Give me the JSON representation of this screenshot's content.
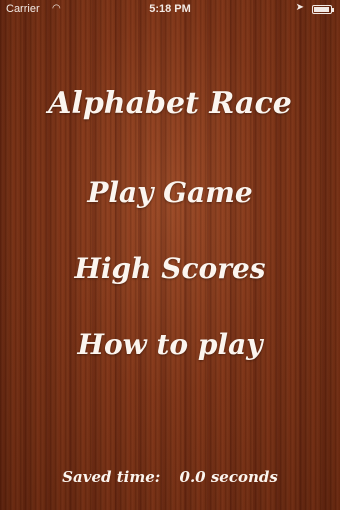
{
  "status_bar": {
    "carrier": "Carrier",
    "wifi_icon": "wifi-icon",
    "time": "5:18 PM",
    "location_icon": "location-arrow-icon",
    "battery_icon": "battery-icon"
  },
  "title": "Alphabet Race",
  "menu": {
    "play": "Play Game",
    "high_scores": "High Scores",
    "how_to": "How to play"
  },
  "saved_time": {
    "label": "Saved time:",
    "value": "0.0 seconds"
  }
}
